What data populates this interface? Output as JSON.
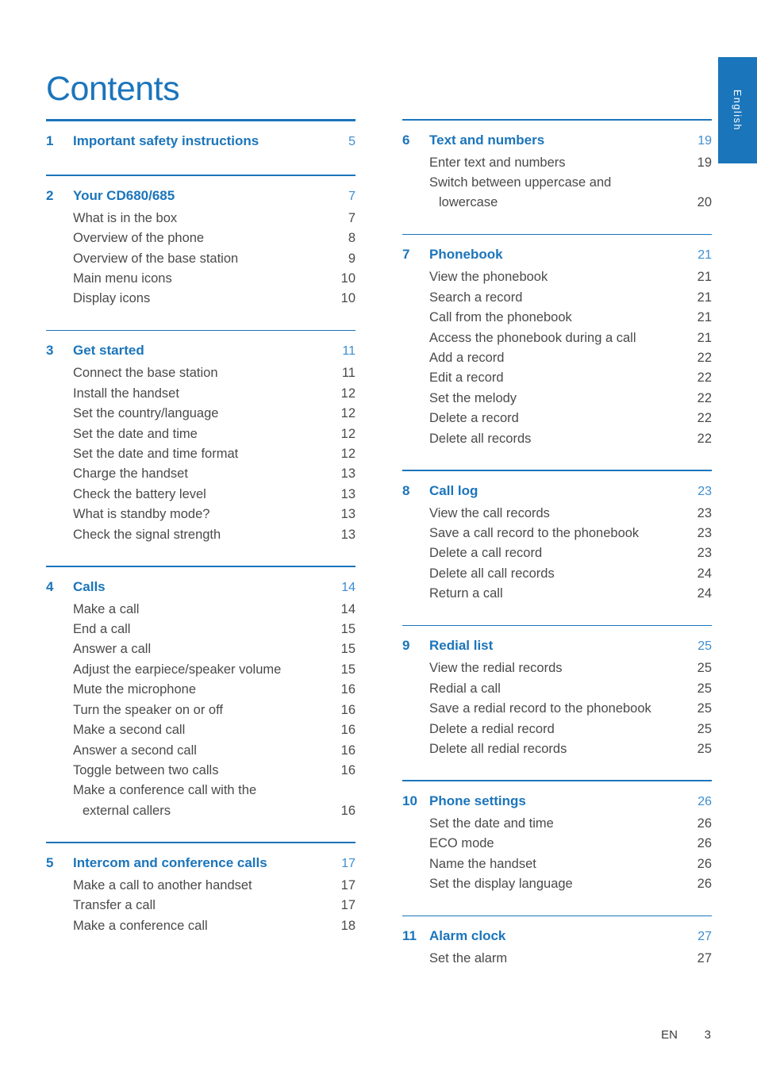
{
  "document": {
    "title": "Contents",
    "language_tab": "English",
    "footer": {
      "lang_code": "EN",
      "page_number": "3"
    },
    "colors": {
      "accent_blue": "#1b75bb",
      "page_number_blue": "#3d8dd0",
      "body_text": "#4a4a4a"
    }
  },
  "columns": [
    {
      "id": "left",
      "sections": [
        {
          "number": "1",
          "title": "Important safety instructions",
          "page": "5",
          "entries": []
        },
        {
          "number": "2",
          "title": "Your CD680/685",
          "page": "7",
          "entries": [
            {
              "label": "What is in the box",
              "page": "7"
            },
            {
              "label": "Overview of the phone",
              "page": "8"
            },
            {
              "label": "Overview of the base station",
              "page": "9"
            },
            {
              "label": "Main menu icons",
              "page": "10"
            },
            {
              "label": "Display icons",
              "page": "10"
            }
          ]
        },
        {
          "number": "3",
          "title": "Get started",
          "page": "11",
          "entries": [
            {
              "label": "Connect the base station",
              "page": "11"
            },
            {
              "label": "Install the handset",
              "page": "12"
            },
            {
              "label": "Set the country/language",
              "page": "12"
            },
            {
              "label": "Set the date and time",
              "page": "12"
            },
            {
              "label": "Set the date and time format",
              "page": "12"
            },
            {
              "label": "Charge the handset",
              "page": "13"
            },
            {
              "label": "Check the battery level",
              "page": "13"
            },
            {
              "label": "What is standby mode?",
              "page": "13"
            },
            {
              "label": "Check the signal strength",
              "page": "13"
            }
          ]
        },
        {
          "number": "4",
          "title": "Calls",
          "page": "14",
          "entries": [
            {
              "label": "Make a call",
              "page": "14"
            },
            {
              "label": "End a call",
              "page": "15"
            },
            {
              "label": "Answer a call",
              "page": "15"
            },
            {
              "label": "Adjust the earpiece/speaker volume",
              "page": "15"
            },
            {
              "label": "Mute the microphone",
              "page": "16"
            },
            {
              "label": "Turn the speaker on or off",
              "page": "16"
            },
            {
              "label": "Make a second call",
              "page": "16"
            },
            {
              "label": "Answer a second call",
              "page": "16"
            },
            {
              "label": "Toggle between two calls",
              "page": "16"
            },
            {
              "label": "Make a conference call with the",
              "page": "",
              "continued": false
            },
            {
              "label": "external callers",
              "page": "16",
              "continued": true
            }
          ]
        },
        {
          "number": "5",
          "title": "Intercom and conference calls",
          "page": "17",
          "entries": [
            {
              "label": "Make a call to another handset",
              "page": "17"
            },
            {
              "label": "Transfer a call",
              "page": "17"
            },
            {
              "label": "Make a conference call",
              "page": "18"
            }
          ]
        }
      ]
    },
    {
      "id": "right",
      "sections": [
        {
          "number": "6",
          "title": "Text and numbers",
          "page": "19",
          "entries": [
            {
              "label": "Enter text and numbers",
              "page": "19"
            },
            {
              "label": "Switch between uppercase and",
              "page": "",
              "continued": false
            },
            {
              "label": "lowercase",
              "page": "20",
              "continued": true
            }
          ]
        },
        {
          "number": "7",
          "title": "Phonebook",
          "page": "21",
          "entries": [
            {
              "label": "View the phonebook",
              "page": "21"
            },
            {
              "label": "Search a record",
              "page": "21"
            },
            {
              "label": "Call from the phonebook",
              "page": "21"
            },
            {
              "label": "Access the phonebook during a call",
              "page": "21"
            },
            {
              "label": "Add a record",
              "page": "22"
            },
            {
              "label": "Edit a record",
              "page": "22"
            },
            {
              "label": "Set the melody",
              "page": "22"
            },
            {
              "label": "Delete a record",
              "page": "22"
            },
            {
              "label": "Delete all records",
              "page": "22"
            }
          ]
        },
        {
          "number": "8",
          "title": "Call log",
          "page": "23",
          "entries": [
            {
              "label": "View the call records",
              "page": "23"
            },
            {
              "label": "Save a call record to the phonebook",
              "page": "23"
            },
            {
              "label": "Delete a call record",
              "page": "23"
            },
            {
              "label": "Delete all call records",
              "page": "24"
            },
            {
              "label": "Return a call",
              "page": "24"
            }
          ]
        },
        {
          "number": "9",
          "title": "Redial list",
          "page": "25",
          "entries": [
            {
              "label": "View the redial records",
              "page": "25"
            },
            {
              "label": "Redial a call",
              "page": "25"
            },
            {
              "label": "Save a redial record to the phonebook",
              "page": "25"
            },
            {
              "label": "Delete a redial record",
              "page": "25"
            },
            {
              "label": "Delete all redial records",
              "page": "25"
            }
          ]
        },
        {
          "number": "10",
          "title": "Phone settings",
          "page": "26",
          "entries": [
            {
              "label": "Set the date and time",
              "page": "26"
            },
            {
              "label": "ECO mode",
              "page": "26"
            },
            {
              "label": "Name the handset",
              "page": "26"
            },
            {
              "label": "Set the display language",
              "page": "26"
            }
          ]
        },
        {
          "number": "11",
          "title": "Alarm clock",
          "page": "27",
          "entries": [
            {
              "label": "Set the alarm",
              "page": "27"
            }
          ]
        }
      ]
    }
  ]
}
